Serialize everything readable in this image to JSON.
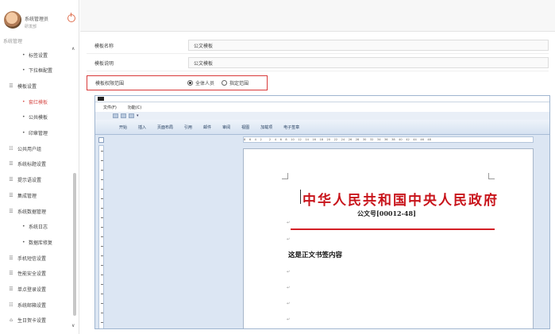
{
  "user": {
    "name": "系统管理员",
    "role": "研发部"
  },
  "sidebar": {
    "section_label": "系统管理",
    "items": [
      {
        "type": "sub",
        "label": "标签设置"
      },
      {
        "type": "sub",
        "label": "下拉框配置"
      },
      {
        "type": "top",
        "icon": "☰",
        "label": "模板设置"
      },
      {
        "type": "sub",
        "label": "套红模板",
        "active": true
      },
      {
        "type": "sub",
        "label": "公共模板"
      },
      {
        "type": "sub",
        "label": "印章管理"
      },
      {
        "type": "top",
        "icon": "☷",
        "label": "公共用户组"
      },
      {
        "type": "top",
        "icon": "☰",
        "label": "系统标题设置"
      },
      {
        "type": "top",
        "icon": "☰",
        "label": "提示语设置"
      },
      {
        "type": "top",
        "icon": "☰",
        "label": "集成管理"
      },
      {
        "type": "top",
        "icon": "☰",
        "label": "系统数据管理"
      },
      {
        "type": "sub",
        "label": "系统日志"
      },
      {
        "type": "sub",
        "label": "数据库修复"
      },
      {
        "type": "top",
        "icon": "☰",
        "label": "手机短信设置"
      },
      {
        "type": "top",
        "icon": "☰",
        "label": "性能安全设置"
      },
      {
        "type": "top",
        "icon": "☰",
        "label": "单点登录设置"
      },
      {
        "type": "top",
        "icon": "☷",
        "label": "系统邮箱设置"
      },
      {
        "type": "top",
        "icon": "⌂",
        "label": "生日贺卡设置"
      }
    ],
    "scroll_up": "∧",
    "scroll_down": "∨"
  },
  "form": {
    "name_label": "模板名称",
    "name_value": "公文模板",
    "desc_label": "模板说明",
    "desc_value": "公文模板",
    "scope_label": "模板权限范围",
    "scope_options": [
      {
        "label": "全体人员",
        "selected": true
      },
      {
        "label": "指定范围",
        "selected": false
      }
    ]
  },
  "editor": {
    "menu": [
      "文件(F)",
      "功能(C)"
    ],
    "quick_arrow": "▾",
    "ribbon_tabs": [
      "开始",
      "插入",
      "页面布局",
      "引用",
      "邮件",
      "审阅",
      "视图",
      "加载项",
      "电子签章"
    ],
    "ruler_ticks": [
      "8",
      "6",
      "4",
      "2",
      "",
      "2",
      "4",
      "6",
      "8",
      "10",
      "12",
      "14",
      "16",
      "18",
      "20",
      "22",
      "24",
      "26",
      "28",
      "30",
      "32",
      "34",
      "36",
      "38",
      "40",
      "42",
      "44",
      "46",
      "48"
    ],
    "document": {
      "title": "中华人民共和国中央人民政府",
      "number": "公文号[00012-48]",
      "body": "这是正文书签内容",
      "para_mark": "↵"
    }
  },
  "colors": {
    "accent": "#d9534f",
    "title_red": "#c8141b",
    "ribbon_blue": "#dce6f3",
    "highlight_border": "#d93a3a"
  }
}
